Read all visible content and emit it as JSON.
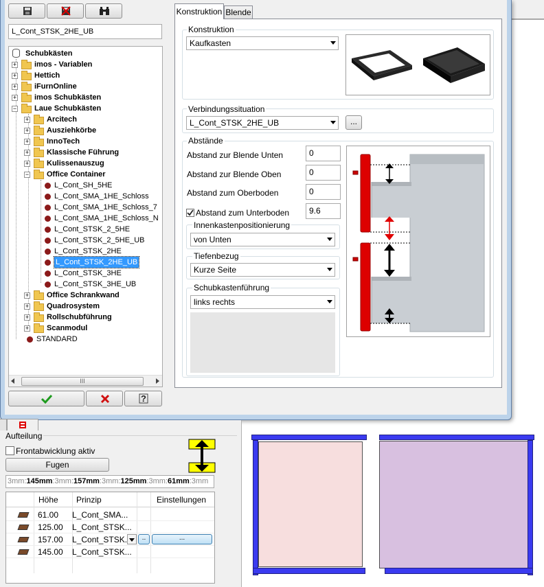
{
  "toolbar": {
    "save_icon": "floppy-icon",
    "delete_icon": "floppy-delete-icon",
    "search_icon": "binoculars-icon"
  },
  "name_field": "L_Cont_STSK_2HE_UB",
  "tree": {
    "root": "Schubkästen",
    "items": [
      {
        "label": "imos - Variablen",
        "bold": true
      },
      {
        "label": "Hettich",
        "bold": true
      },
      {
        "label": "iFurnOnline",
        "bold": true
      },
      {
        "label": "imos Schubkästen",
        "bold": true
      },
      {
        "label": "Laue Schubkästen",
        "bold": true
      },
      {
        "label": "Arcitech",
        "bold": true
      },
      {
        "label": "Ausziehkörbe",
        "bold": true
      },
      {
        "label": "InnoTech",
        "bold": true
      },
      {
        "label": "Klassische Führung",
        "bold": true
      },
      {
        "label": "Kulissenauszug",
        "bold": true
      },
      {
        "label": "Office Container",
        "bold": true
      },
      {
        "label": "L_Cont_SH_5HE",
        "bold": false
      },
      {
        "label": "L_Cont_SMA_1HE_Schloss",
        "bold": false
      },
      {
        "label": "L_Cont_SMA_1HE_Schloss_7",
        "bold": false
      },
      {
        "label": "L_Cont_SMA_1HE_Schloss_N",
        "bold": false
      },
      {
        "label": "L_Cont_STSK_2_5HE",
        "bold": false
      },
      {
        "label": "L_Cont_STSK_2_5HE_UB",
        "bold": false
      },
      {
        "label": "L_Cont_STSK_2HE",
        "bold": false
      },
      {
        "label": "L_Cont_STSK_2HE_UB",
        "bold": false
      },
      {
        "label": "L_Cont_STSK_3HE",
        "bold": false
      },
      {
        "label": "L_Cont_STSK_3HE_UB",
        "bold": false
      },
      {
        "label": "Office Schrankwand",
        "bold": true
      },
      {
        "label": "Quadrosystem",
        "bold": true
      },
      {
        "label": "Rollschubführung",
        "bold": true
      },
      {
        "label": "Scanmodul",
        "bold": true
      },
      {
        "label": "STANDARD",
        "bold": false
      }
    ],
    "scroll_label": "III"
  },
  "footer_buttons": {
    "ok_icon": "checkmark-icon",
    "cancel_icon": "x-cross-icon",
    "help_icon": "help-question-icon"
  },
  "tabs": [
    "Konstruktion",
    "Blende"
  ],
  "konstruktion": {
    "group_label": "Konstruktion",
    "combo_value": "Kaufkasten"
  },
  "verbindung": {
    "group_label": "Verbindungssituation",
    "combo_value": "L_Cont_STSK_2HE_UB",
    "browse_label": "..."
  },
  "abstaende": {
    "group_label": "Abstände",
    "fields": [
      {
        "label": "Abstand zur Blende Unten",
        "value": "0"
      },
      {
        "label": "Abstand zur Blende Oben",
        "value": "0"
      },
      {
        "label": "Abstand zum Oberboden",
        "value": "0"
      },
      {
        "label": "Abstand zum Unterboden",
        "value": "9.6"
      }
    ],
    "checkbox_checked": true
  },
  "innenkasten": {
    "group_label": "Innenkastenpositionierung",
    "value": "von Unten"
  },
  "tiefenbezug": {
    "group_label": "Tiefenbezug",
    "value": "Kurze Seite"
  },
  "fuehrung": {
    "group_label": "Schubkastenführung",
    "value": "links rechts"
  },
  "aufteilung": {
    "label": "Aufteilung",
    "frontabwicklung": "Frontabwicklung aktiv",
    "fugen_button": "Fugen",
    "formula": [
      {
        "t": "3mm:",
        "bold": false
      },
      {
        "t": "145mm",
        "bold": true
      },
      {
        "t": ":3mm:",
        "bold": false
      },
      {
        "t": "157mm",
        "bold": true
      },
      {
        "t": ":3mm:",
        "bold": false
      },
      {
        "t": "125mm",
        "bold": true
      },
      {
        "t": ":3mm:",
        "bold": false
      },
      {
        "t": "61mm",
        "bold": true
      },
      {
        "t": ":3mm",
        "bold": false
      }
    ],
    "columns": [
      "Höhe",
      "Prinzip",
      "Einstellungen"
    ],
    "rows": [
      {
        "hoehe": "61.00",
        "prinzip": "L_Cont_SMA..."
      },
      {
        "hoehe": "125.00",
        "prinzip": "L_Cont_STSK..."
      },
      {
        "hoehe": "157.00",
        "prinzip": "L_Cont_STSK."
      },
      {
        "hoehe": "145.00",
        "prinzip": "L_Cont_STSK..."
      }
    ],
    "selected_small_btn": "..",
    "selected_settings_btn": "..."
  }
}
